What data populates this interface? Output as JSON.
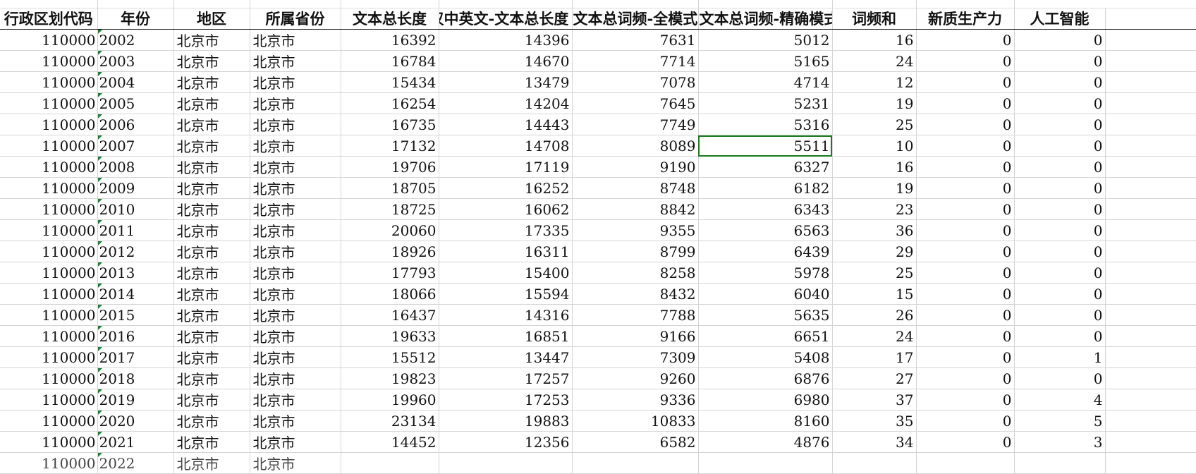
{
  "columns": [
    "行政区划代码",
    "年份",
    "地区",
    "所属省份",
    "文本总长度",
    "汉中英文-文本总长度",
    "文本总词频-全模式",
    "文本总词频-精确模式",
    "词频和",
    "新质生产力",
    "人工智能"
  ],
  "rows": [
    [
      "110000",
      "2002",
      "北京市",
      "北京市",
      "16392",
      "14396",
      "7631",
      "5012",
      "16",
      "0",
      "0"
    ],
    [
      "110000",
      "2003",
      "北京市",
      "北京市",
      "16784",
      "14670",
      "7714",
      "5165",
      "24",
      "0",
      "0"
    ],
    [
      "110000",
      "2004",
      "北京市",
      "北京市",
      "15434",
      "13479",
      "7078",
      "4714",
      "12",
      "0",
      "0"
    ],
    [
      "110000",
      "2005",
      "北京市",
      "北京市",
      "16254",
      "14204",
      "7645",
      "5231",
      "19",
      "0",
      "0"
    ],
    [
      "110000",
      "2006",
      "北京市",
      "北京市",
      "16735",
      "14443",
      "7749",
      "5316",
      "25",
      "0",
      "0"
    ],
    [
      "110000",
      "2007",
      "北京市",
      "北京市",
      "17132",
      "14708",
      "8089",
      "5511",
      "10",
      "0",
      "0"
    ],
    [
      "110000",
      "2008",
      "北京市",
      "北京市",
      "19706",
      "17119",
      "9190",
      "6327",
      "16",
      "0",
      "0"
    ],
    [
      "110000",
      "2009",
      "北京市",
      "北京市",
      "18705",
      "16252",
      "8748",
      "6182",
      "19",
      "0",
      "0"
    ],
    [
      "110000",
      "2010",
      "北京市",
      "北京市",
      "18725",
      "16062",
      "8842",
      "6343",
      "23",
      "0",
      "0"
    ],
    [
      "110000",
      "2011",
      "北京市",
      "北京市",
      "20060",
      "17335",
      "9355",
      "6563",
      "36",
      "0",
      "0"
    ],
    [
      "110000",
      "2012",
      "北京市",
      "北京市",
      "18926",
      "16311",
      "8799",
      "6439",
      "29",
      "0",
      "0"
    ],
    [
      "110000",
      "2013",
      "北京市",
      "北京市",
      "17793",
      "15400",
      "8258",
      "5978",
      "25",
      "0",
      "0"
    ],
    [
      "110000",
      "2014",
      "北京市",
      "北京市",
      "18066",
      "15594",
      "8432",
      "6040",
      "15",
      "0",
      "0"
    ],
    [
      "110000",
      "2015",
      "北京市",
      "北京市",
      "16437",
      "14316",
      "7788",
      "5635",
      "26",
      "0",
      "0"
    ],
    [
      "110000",
      "2016",
      "北京市",
      "北京市",
      "19633",
      "16851",
      "9166",
      "6651",
      "24",
      "0",
      "0"
    ],
    [
      "110000",
      "2017",
      "北京市",
      "北京市",
      "15512",
      "13447",
      "7309",
      "5408",
      "17",
      "0",
      "1"
    ],
    [
      "110000",
      "2018",
      "北京市",
      "北京市",
      "19823",
      "17257",
      "9260",
      "6876",
      "27",
      "0",
      "0"
    ],
    [
      "110000",
      "2019",
      "北京市",
      "北京市",
      "19960",
      "17253",
      "9336",
      "6980",
      "37",
      "0",
      "4"
    ],
    [
      "110000",
      "2020",
      "北京市",
      "北京市",
      "23134",
      "19883",
      "10833",
      "8160",
      "35",
      "0",
      "5"
    ],
    [
      "110000",
      "2021",
      "北京市",
      "北京市",
      "14452",
      "12356",
      "6582",
      "4876",
      "34",
      "0",
      "3"
    ],
    [
      "110000",
      "2022",
      "北京市",
      "北京市",
      "",
      "",
      "",
      "",
      "",
      "",
      ""
    ]
  ],
  "selected_cell": {
    "row": 5,
    "col": 7
  }
}
